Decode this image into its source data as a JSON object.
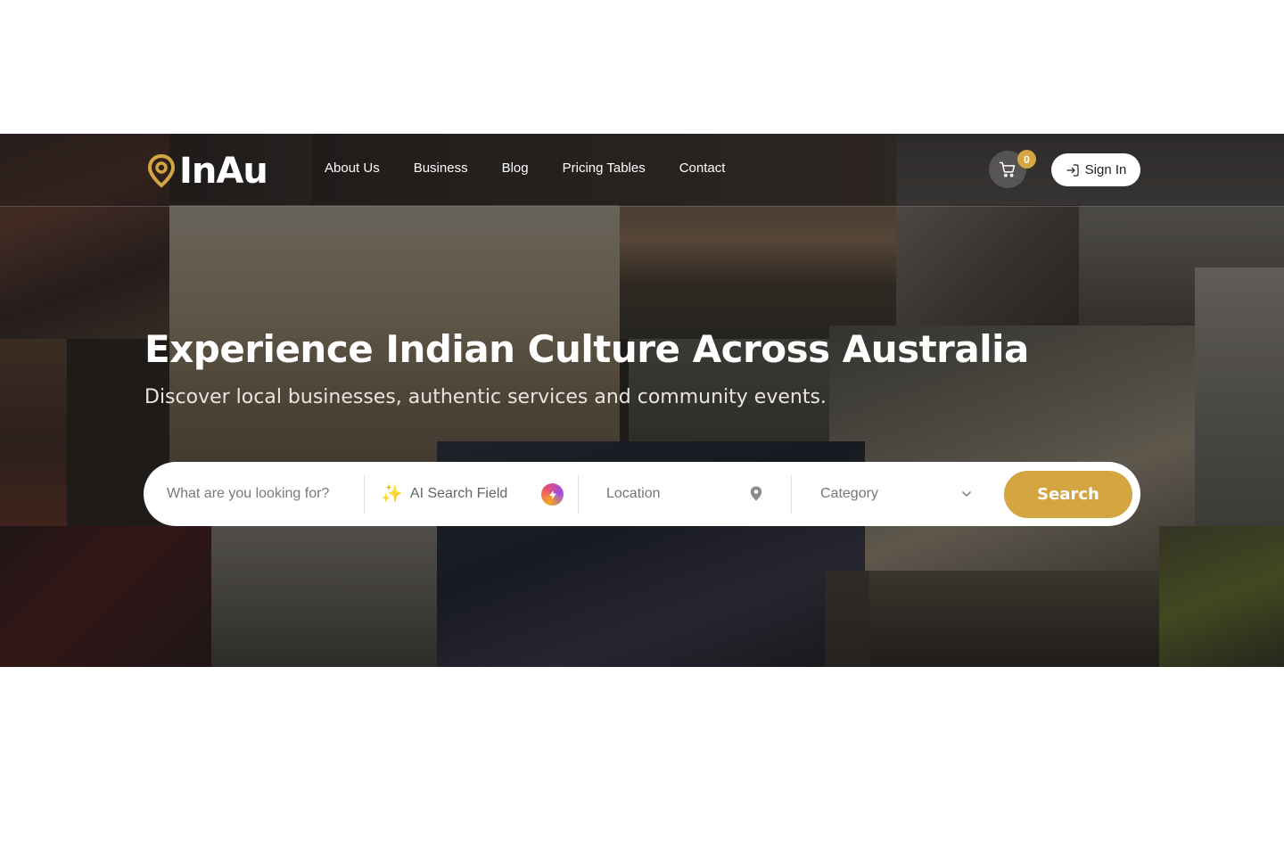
{
  "brand": {
    "name": "InAu",
    "accent": "#d4a642"
  },
  "nav": {
    "items": [
      {
        "label": "About Us"
      },
      {
        "label": "Business"
      },
      {
        "label": "Blog"
      },
      {
        "label": "Pricing Tables"
      },
      {
        "label": "Contact"
      }
    ]
  },
  "cart": {
    "count": "0",
    "icon": "cart-icon"
  },
  "signin": {
    "label": "Sign In",
    "icon": "sign-in-icon"
  },
  "hero": {
    "title": "Experience Indian Culture Across Australia",
    "subtitle": "Discover local businesses, authentic services and community events."
  },
  "search": {
    "what_placeholder": "What are you looking for?",
    "ai_label": "AI Search Field",
    "ai_icon": "sparkles-icon",
    "location_label": "Location",
    "category_label": "Category",
    "button_label": "Search"
  }
}
